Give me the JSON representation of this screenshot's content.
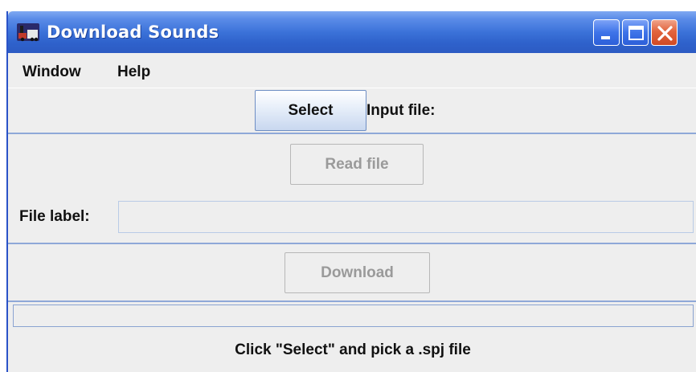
{
  "window": {
    "title": "Download Sounds",
    "controls": [
      "minimize-icon",
      "maximize-icon",
      "close-icon"
    ]
  },
  "menu": {
    "items": [
      "Window",
      "Help"
    ]
  },
  "input_panel": {
    "select_button": "Select",
    "input_file_label": "Input file:"
  },
  "read_panel": {
    "read_button": "Read file",
    "file_label": "File label:",
    "file_label_value": ""
  },
  "download_panel": {
    "download_button": "Download"
  },
  "progress": {
    "value": 0
  },
  "status": "Click \"Select\" and pick a .spj file",
  "colors": {
    "titlebar": "#3b72d9",
    "close_button": "#e2643d",
    "panel_background": "#eeeeee",
    "disabled_text": "#9a9a9a"
  }
}
